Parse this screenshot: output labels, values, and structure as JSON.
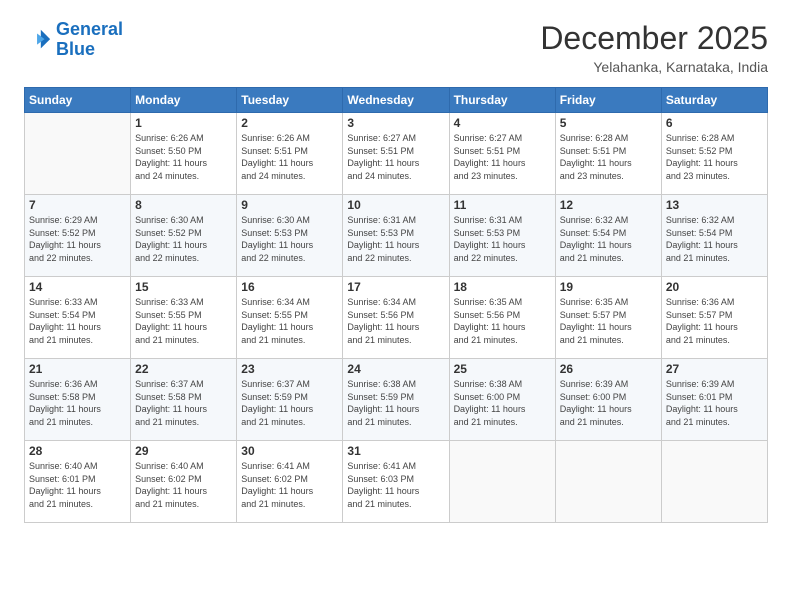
{
  "header": {
    "logo_line1": "General",
    "logo_line2": "Blue",
    "month_title": "December 2025",
    "location": "Yelahanka, Karnataka, India"
  },
  "weekdays": [
    "Sunday",
    "Monday",
    "Tuesday",
    "Wednesday",
    "Thursday",
    "Friday",
    "Saturday"
  ],
  "weeks": [
    [
      {
        "day": "",
        "info": ""
      },
      {
        "day": "1",
        "info": "Sunrise: 6:26 AM\nSunset: 5:50 PM\nDaylight: 11 hours\nand 24 minutes."
      },
      {
        "day": "2",
        "info": "Sunrise: 6:26 AM\nSunset: 5:51 PM\nDaylight: 11 hours\nand 24 minutes."
      },
      {
        "day": "3",
        "info": "Sunrise: 6:27 AM\nSunset: 5:51 PM\nDaylight: 11 hours\nand 24 minutes."
      },
      {
        "day": "4",
        "info": "Sunrise: 6:27 AM\nSunset: 5:51 PM\nDaylight: 11 hours\nand 23 minutes."
      },
      {
        "day": "5",
        "info": "Sunrise: 6:28 AM\nSunset: 5:51 PM\nDaylight: 11 hours\nand 23 minutes."
      },
      {
        "day": "6",
        "info": "Sunrise: 6:28 AM\nSunset: 5:52 PM\nDaylight: 11 hours\nand 23 minutes."
      }
    ],
    [
      {
        "day": "7",
        "info": "Sunrise: 6:29 AM\nSunset: 5:52 PM\nDaylight: 11 hours\nand 22 minutes."
      },
      {
        "day": "8",
        "info": "Sunrise: 6:30 AM\nSunset: 5:52 PM\nDaylight: 11 hours\nand 22 minutes."
      },
      {
        "day": "9",
        "info": "Sunrise: 6:30 AM\nSunset: 5:53 PM\nDaylight: 11 hours\nand 22 minutes."
      },
      {
        "day": "10",
        "info": "Sunrise: 6:31 AM\nSunset: 5:53 PM\nDaylight: 11 hours\nand 22 minutes."
      },
      {
        "day": "11",
        "info": "Sunrise: 6:31 AM\nSunset: 5:53 PM\nDaylight: 11 hours\nand 22 minutes."
      },
      {
        "day": "12",
        "info": "Sunrise: 6:32 AM\nSunset: 5:54 PM\nDaylight: 11 hours\nand 21 minutes."
      },
      {
        "day": "13",
        "info": "Sunrise: 6:32 AM\nSunset: 5:54 PM\nDaylight: 11 hours\nand 21 minutes."
      }
    ],
    [
      {
        "day": "14",
        "info": "Sunrise: 6:33 AM\nSunset: 5:54 PM\nDaylight: 11 hours\nand 21 minutes."
      },
      {
        "day": "15",
        "info": "Sunrise: 6:33 AM\nSunset: 5:55 PM\nDaylight: 11 hours\nand 21 minutes."
      },
      {
        "day": "16",
        "info": "Sunrise: 6:34 AM\nSunset: 5:55 PM\nDaylight: 11 hours\nand 21 minutes."
      },
      {
        "day": "17",
        "info": "Sunrise: 6:34 AM\nSunset: 5:56 PM\nDaylight: 11 hours\nand 21 minutes."
      },
      {
        "day": "18",
        "info": "Sunrise: 6:35 AM\nSunset: 5:56 PM\nDaylight: 11 hours\nand 21 minutes."
      },
      {
        "day": "19",
        "info": "Sunrise: 6:35 AM\nSunset: 5:57 PM\nDaylight: 11 hours\nand 21 minutes."
      },
      {
        "day": "20",
        "info": "Sunrise: 6:36 AM\nSunset: 5:57 PM\nDaylight: 11 hours\nand 21 minutes."
      }
    ],
    [
      {
        "day": "21",
        "info": "Sunrise: 6:36 AM\nSunset: 5:58 PM\nDaylight: 11 hours\nand 21 minutes."
      },
      {
        "day": "22",
        "info": "Sunrise: 6:37 AM\nSunset: 5:58 PM\nDaylight: 11 hours\nand 21 minutes."
      },
      {
        "day": "23",
        "info": "Sunrise: 6:37 AM\nSunset: 5:59 PM\nDaylight: 11 hours\nand 21 minutes."
      },
      {
        "day": "24",
        "info": "Sunrise: 6:38 AM\nSunset: 5:59 PM\nDaylight: 11 hours\nand 21 minutes."
      },
      {
        "day": "25",
        "info": "Sunrise: 6:38 AM\nSunset: 6:00 PM\nDaylight: 11 hours\nand 21 minutes."
      },
      {
        "day": "26",
        "info": "Sunrise: 6:39 AM\nSunset: 6:00 PM\nDaylight: 11 hours\nand 21 minutes."
      },
      {
        "day": "27",
        "info": "Sunrise: 6:39 AM\nSunset: 6:01 PM\nDaylight: 11 hours\nand 21 minutes."
      }
    ],
    [
      {
        "day": "28",
        "info": "Sunrise: 6:40 AM\nSunset: 6:01 PM\nDaylight: 11 hours\nand 21 minutes."
      },
      {
        "day": "29",
        "info": "Sunrise: 6:40 AM\nSunset: 6:02 PM\nDaylight: 11 hours\nand 21 minutes."
      },
      {
        "day": "30",
        "info": "Sunrise: 6:41 AM\nSunset: 6:02 PM\nDaylight: 11 hours\nand 21 minutes."
      },
      {
        "day": "31",
        "info": "Sunrise: 6:41 AM\nSunset: 6:03 PM\nDaylight: 11 hours\nand 21 minutes."
      },
      {
        "day": "",
        "info": ""
      },
      {
        "day": "",
        "info": ""
      },
      {
        "day": "",
        "info": ""
      }
    ]
  ]
}
